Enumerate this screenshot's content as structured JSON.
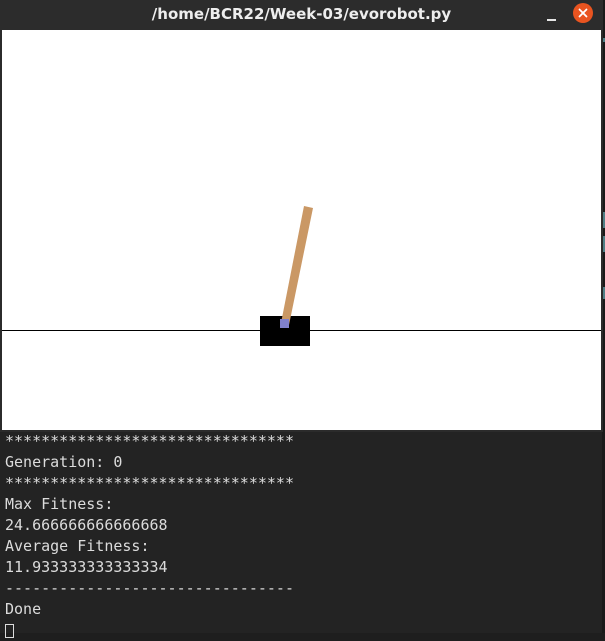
{
  "window": {
    "title": "/home/BCR22/Week-03/evorobot.py",
    "controls": {
      "minimize_icon": "minimize-icon",
      "close_icon": "close-icon",
      "close_color": "#e95420"
    }
  },
  "simulation": {
    "background": "#ffffff",
    "track_color": "#000000",
    "cart_color": "#000000",
    "pole_color": "#ca9865",
    "axle_color": "#8181cb"
  },
  "terminal": {
    "lines": [
      "********************************",
      "Generation: 0",
      "********************************",
      "Max Fitness:",
      "24.666666666666668",
      "Average Fitness:",
      "11.933333333333334",
      "--------------------------------",
      "Done"
    ]
  }
}
